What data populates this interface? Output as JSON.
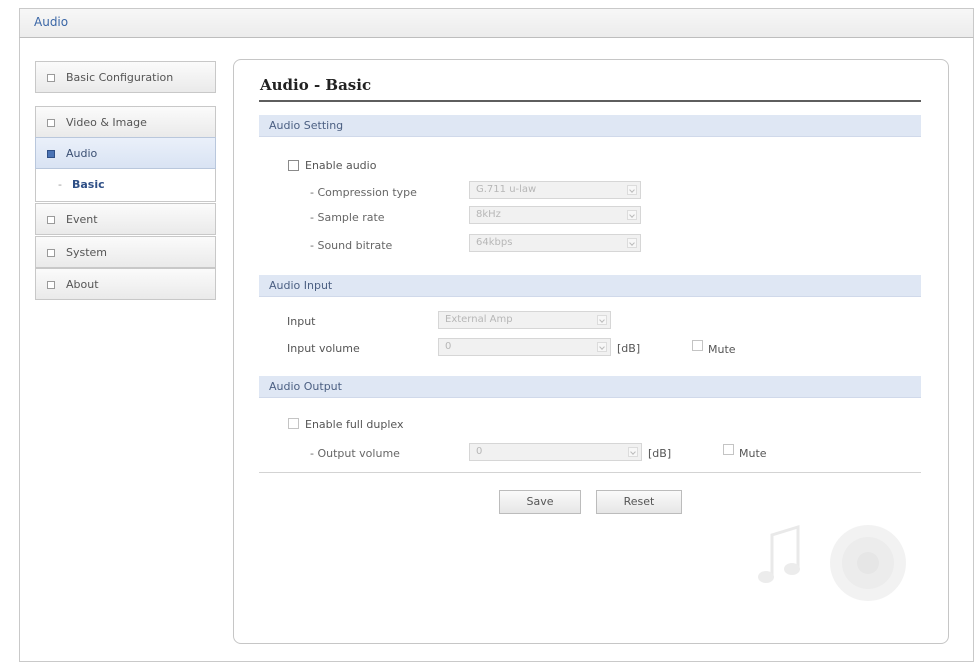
{
  "window": {
    "title": "Audio"
  },
  "sidebar": {
    "items": [
      {
        "label": "Basic Configuration"
      },
      {
        "label": "Video & Image"
      },
      {
        "label": "Audio"
      },
      {
        "label": "Event"
      },
      {
        "label": "System"
      },
      {
        "label": "About"
      }
    ],
    "sub_dash": "-",
    "sub_item": "Basic"
  },
  "page": {
    "title": "Audio - Basic"
  },
  "audio_setting": {
    "header": "Audio Setting",
    "enable_label": "Enable audio",
    "compression_label": "- Compression type",
    "compression_value": "G.711 u-law",
    "sample_label": "- Sample rate",
    "sample_value": "8kHz",
    "bitrate_label": "- Sound bitrate",
    "bitrate_value": "64kbps"
  },
  "audio_input": {
    "header": "Audio Input",
    "input_label": "Input",
    "input_value": "External Amp",
    "volume_label": "Input volume",
    "volume_value": "0",
    "unit": "[dB]",
    "mute_label": "Mute"
  },
  "audio_output": {
    "header": "Audio Output",
    "duplex_label": "Enable full duplex",
    "volume_label": "- Output volume",
    "volume_value": "0",
    "unit": "[dB]",
    "mute_label": "Mute"
  },
  "buttons": {
    "save": "Save",
    "reset": "Reset"
  },
  "colors": {
    "accent": "#3a66a6",
    "section_bg": "#dfe7f4",
    "active_nav": "#d9e3f3"
  }
}
